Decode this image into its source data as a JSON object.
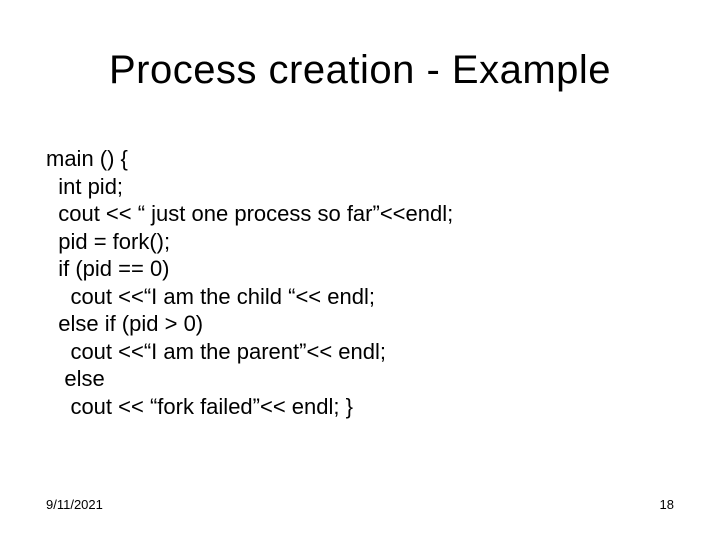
{
  "slide": {
    "title": "Process creation - Example",
    "code_lines": [
      "main () {",
      "  int pid;",
      "  cout << “ just one process so far”<<endl;",
      "  pid = fork();",
      "  if (pid == 0)",
      "    cout <<“I am the child “<< endl;",
      "  else if (pid > 0)",
      "    cout <<“I am the parent”<< endl;",
      "   else",
      "    cout << “fork failed”<< endl; }"
    ],
    "footer": {
      "date": "9/11/2021",
      "page": "18"
    }
  }
}
